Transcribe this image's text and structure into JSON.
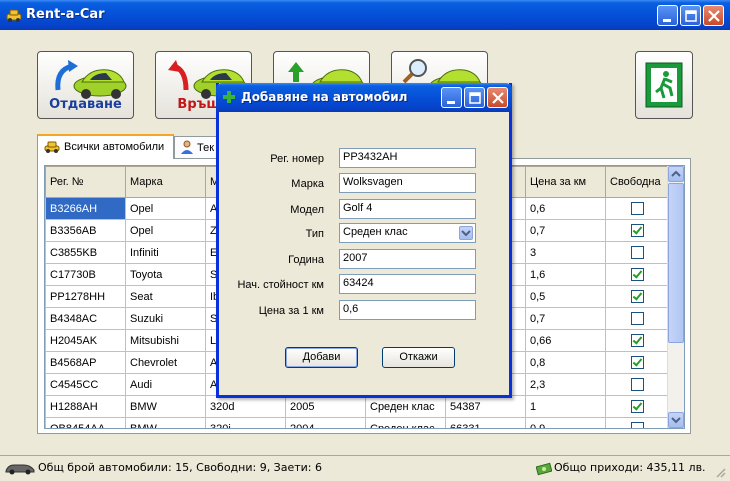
{
  "window": {
    "title": "Rent-a-Car"
  },
  "toolbar": {
    "rent_label": "Отдаване",
    "return_label": "Връща",
    "exit_icon": "exit-door-icon"
  },
  "tabs": [
    {
      "label": "Всички автомобили"
    },
    {
      "label": "Тек"
    }
  ],
  "grid": {
    "columns": [
      "Рег. №",
      "Марка",
      "М",
      "",
      "",
      "",
      "Цена за км",
      "Свободна"
    ],
    "rows": [
      {
        "reg": "B3266AH",
        "brand": "Opel",
        "c3": "A",
        "c4": "",
        "c5": "",
        "c6": "",
        "price": "0,6",
        "free": false
      },
      {
        "reg": "B3356AB",
        "brand": "Opel",
        "c3": "Z",
        "c4": "",
        "c5": "",
        "c6": "",
        "price": "0,7",
        "free": true
      },
      {
        "reg": "C3855KB",
        "brand": "Infiniti",
        "c3": "E",
        "c4": "",
        "c5": "",
        "c6": "",
        "price": "3",
        "free": false
      },
      {
        "reg": "C17730B",
        "brand": "Toyota",
        "c3": "S",
        "c4": "",
        "c5": "",
        "c6": "",
        "price": "1,6",
        "free": true
      },
      {
        "reg": "PP1278HH",
        "brand": "Seat",
        "c3": "Ib",
        "c4": "",
        "c5": "",
        "c6": "",
        "price": "0,5",
        "free": true
      },
      {
        "reg": "B4348AC",
        "brand": "Suzuki",
        "c3": "S",
        "c4": "",
        "c5": "",
        "c6": "",
        "price": "0,7",
        "free": false
      },
      {
        "reg": "H2045AK",
        "brand": "Mitsubishi",
        "c3": "L",
        "c4": "",
        "c5": "",
        "c6": "",
        "price": "0,66",
        "free": true
      },
      {
        "reg": "B4568AP",
        "brand": "Chevrolet",
        "c3": "A",
        "c4": "",
        "c5": "",
        "c6": "",
        "price": "0,8",
        "free": true
      },
      {
        "reg": "C4545CC",
        "brand": "Audi",
        "c3": "A",
        "c4": "",
        "c5": "",
        "c6": "",
        "price": "2,3",
        "free": false
      },
      {
        "reg": "H1288AH",
        "brand": "BMW",
        "c3": "320d",
        "c4": "2005",
        "c5": "Среден клас",
        "c6": "54387",
        "price": "1",
        "free": true
      },
      {
        "reg": "OB8454AA",
        "brand": "BMW",
        "c3": "320i",
        "c4": "2004",
        "c5": "Среден клас",
        "c6": "66331",
        "price": "0,9",
        "free": false
      }
    ]
  },
  "dialog": {
    "title": "Добавяне на автомобил",
    "labels": {
      "reg": "Рег. номер",
      "brand": "Марка",
      "model": "Модел",
      "type": "Тип",
      "year": "Година",
      "km": "Нач. стойност км",
      "price": "Цена за 1 км"
    },
    "values": {
      "reg": "PP3432AH",
      "brand": "Wolksvagen",
      "model": "Golf 4",
      "type": "Среден клас",
      "year": "2007",
      "km": "63424",
      "price": "0,6"
    },
    "add_label": "Добави",
    "cancel_label": "Откажи"
  },
  "status": {
    "left": "Общ брой автомобили: 15, Свободни: 9, Заети: 6",
    "right": "Общо приходи: 435,11 лв."
  },
  "colors": {
    "title_bar": "#0550d7",
    "selection": "#316ac5",
    "dialog_border": "#0831d9"
  }
}
